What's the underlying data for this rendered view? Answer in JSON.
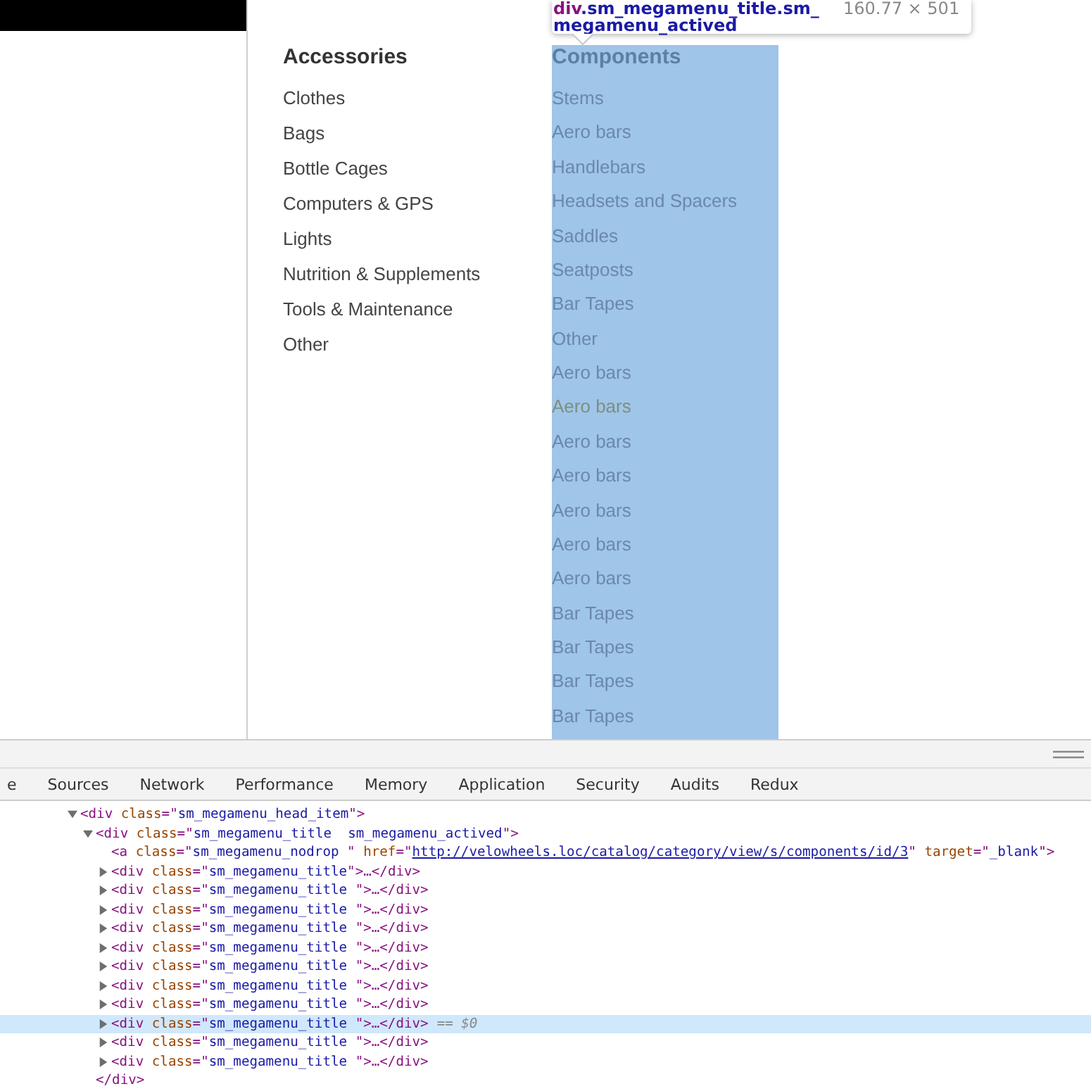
{
  "inspect_tooltip": {
    "tag": "div",
    "classes": ".sm_megamenu_title.sm_megamenu_actived",
    "size": "160.77 × 501"
  },
  "menu": {
    "columns": [
      {
        "title": "Accessories",
        "highlighted": false,
        "items": [
          {
            "label": "Clothes",
            "dimmed": false
          },
          {
            "label": "Bags",
            "dimmed": false
          },
          {
            "label": "Bottle Cages",
            "dimmed": false
          },
          {
            "label": "Computers & GPS",
            "dimmed": false
          },
          {
            "label": "Lights",
            "dimmed": false
          },
          {
            "label": "Nutrition & Supplements",
            "dimmed": false
          },
          {
            "label": "Tools & Maintenance",
            "dimmed": false
          },
          {
            "label": "Other",
            "dimmed": false
          }
        ]
      },
      {
        "title": "Components",
        "highlighted": true,
        "items": [
          {
            "label": "Stems",
            "dimmed": false
          },
          {
            "label": "Aero bars",
            "dimmed": false
          },
          {
            "label": "Handlebars",
            "dimmed": false
          },
          {
            "label": "Headsets and Spacers",
            "dimmed": false
          },
          {
            "label": "Saddles",
            "dimmed": false
          },
          {
            "label": "Seatposts",
            "dimmed": false
          },
          {
            "label": "Bar Tapes",
            "dimmed": false
          },
          {
            "label": "Other",
            "dimmed": false
          },
          {
            "label": "Aero bars",
            "dimmed": false
          },
          {
            "label": "Aero bars",
            "dimmed": true
          },
          {
            "label": "Aero bars",
            "dimmed": false
          },
          {
            "label": "Aero bars",
            "dimmed": false
          },
          {
            "label": "Aero bars",
            "dimmed": false
          },
          {
            "label": "Aero bars",
            "dimmed": false
          },
          {
            "label": "Aero bars",
            "dimmed": false
          },
          {
            "label": "Bar Tapes",
            "dimmed": false
          },
          {
            "label": "Bar Tapes",
            "dimmed": false
          },
          {
            "label": "Bar Tapes",
            "dimmed": false
          },
          {
            "label": "Bar Tapes",
            "dimmed": false
          }
        ]
      }
    ]
  },
  "devtools": {
    "tabs": [
      {
        "label": "e",
        "selected": false
      },
      {
        "label": "Sources",
        "selected": false
      },
      {
        "label": "Network",
        "selected": false
      },
      {
        "label": "Performance",
        "selected": false
      },
      {
        "label": "Memory",
        "selected": false
      },
      {
        "label": "Application",
        "selected": false
      },
      {
        "label": "Security",
        "selected": false
      },
      {
        "label": "Audits",
        "selected": false
      },
      {
        "label": "Redux",
        "selected": false
      }
    ],
    "dom_tree": [
      {
        "text": "<div class=\"sm_megamenu_head_item\">",
        "expanded": true,
        "selected": false,
        "children": [
          {
            "text": "<div class=\"sm_megamenu_title  sm_megamenu_actived\">",
            "expanded": true,
            "selected": false,
            "closing": "</div>",
            "children": [
              {
                "text": "<a class=\"sm_megamenu_nodrop \" href=\"http://velowheels.loc/catalog/category/view/s/components/id/3\" target=\"_blank\">",
                "selected": false
              },
              {
                "text": "<div class=\"sm_megamenu_title\">…</div>",
                "expanded": false,
                "selected": false
              },
              {
                "text": "<div class=\"sm_megamenu_title \">…</div>",
                "expanded": false,
                "selected": false
              },
              {
                "text": "<div class=\"sm_megamenu_title \">…</div>",
                "expanded": false,
                "selected": false
              },
              {
                "text": "<div class=\"sm_megamenu_title \">…</div>",
                "expanded": false,
                "selected": false
              },
              {
                "text": "<div class=\"sm_megamenu_title \">…</div>",
                "expanded": false,
                "selected": false
              },
              {
                "text": "<div class=\"sm_megamenu_title \">…</div>",
                "expanded": false,
                "selected": false
              },
              {
                "text": "<div class=\"sm_megamenu_title \">…</div>",
                "expanded": false,
                "selected": false
              },
              {
                "text": "<div class=\"sm_megamenu_title \">…</div>",
                "expanded": false,
                "selected": false
              },
              {
                "text": "<div class=\"sm_megamenu_title \">…</div>",
                "expanded": false,
                "selected": true,
                "suffix": "== $0"
              },
              {
                "text": "<div class=\"sm_megamenu_title \">…</div>",
                "expanded": false,
                "selected": false
              },
              {
                "text": "<div class=\"sm_megamenu_title \">…</div>",
                "expanded": false,
                "selected": false
              }
            ]
          }
        ]
      }
    ]
  }
}
